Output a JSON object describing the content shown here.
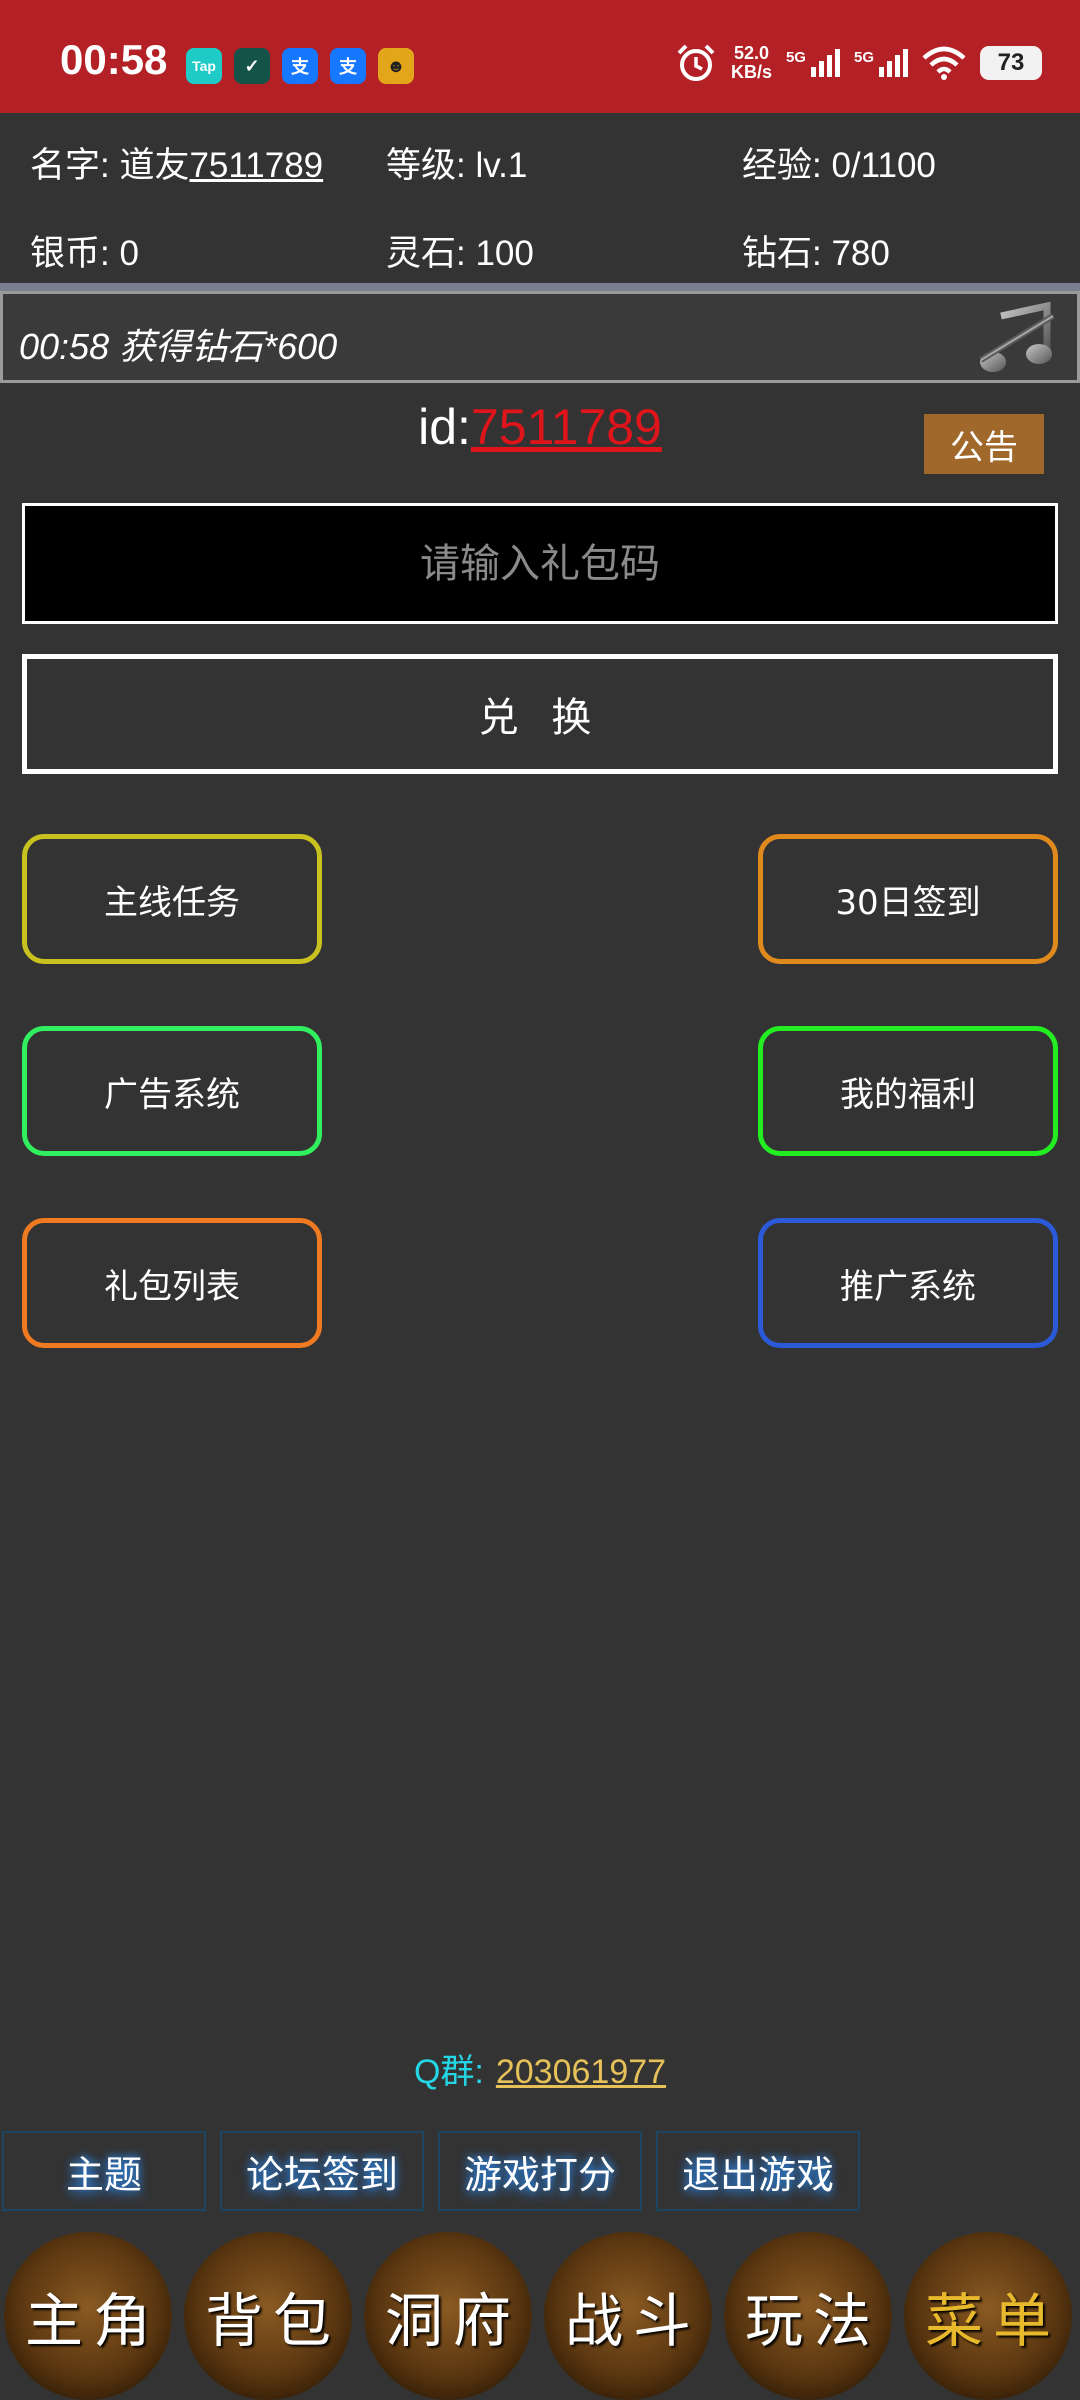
{
  "status_bar": {
    "time": "00:58",
    "apps": [
      {
        "icon": "taptap-app-icon",
        "label": "Tap",
        "color": "#1ecbc7"
      },
      {
        "icon": "game-app-icon",
        "label": "✓",
        "color": "#14534a"
      },
      {
        "icon": "alipay-app-icon",
        "label": "支",
        "color": "#1677ff"
      },
      {
        "icon": "alipay-app-icon",
        "label": "支",
        "color": "#1677ff"
      },
      {
        "icon": "game-character-app-icon",
        "label": "☻",
        "color": "#e3a51a"
      }
    ],
    "speed_value": "52.0",
    "speed_unit": "KB/s",
    "net1": "5G",
    "net2": "5G",
    "battery": "73"
  },
  "info": {
    "name_label": "名字: ",
    "name_prefix": "道友",
    "name_value": "7511789",
    "level": "等级: lv.1",
    "exp": "经验: 0/1100",
    "silver": "银币: 0",
    "spirit_stone": "灵石: 100",
    "diamond": "钻石: 780"
  },
  "notice": {
    "text": "00:58 获得钻石*600",
    "icon": "music-off-icon"
  },
  "id_label": "id:",
  "id_value": "7511789",
  "announce_label": "公告",
  "code_input": {
    "value": "",
    "placeholder": "请输入礼包码"
  },
  "redeem_label": "兑 换",
  "menu_buttons": [
    {
      "label": "主线任务",
      "color": "#c9c11f"
    },
    {
      "label": "30日签到",
      "color": "#e08a1e"
    },
    {
      "label": "广告系统",
      "color": "#31ef5f"
    },
    {
      "label": "我的福利",
      "color": "#22ee22"
    },
    {
      "label": "礼包列表",
      "color": "#f07a21"
    },
    {
      "label": "推广系统",
      "color": "#2a5ad8"
    }
  ],
  "qq": {
    "label": "Q群:",
    "number": "203061977"
  },
  "tabs": [
    "主题",
    "论坛签到",
    "游戏打分",
    "退出游戏"
  ],
  "nav": [
    "主角",
    "背包",
    "洞府",
    "战斗",
    "玩法",
    "菜单"
  ],
  "colors": {
    "status_bar": "#b32025",
    "background": "#333333",
    "id_value": "#e0141b",
    "qq_label": "#24d6e6",
    "qq_number": "#e6c15a",
    "nav_gold_text": "#e8b92c"
  }
}
